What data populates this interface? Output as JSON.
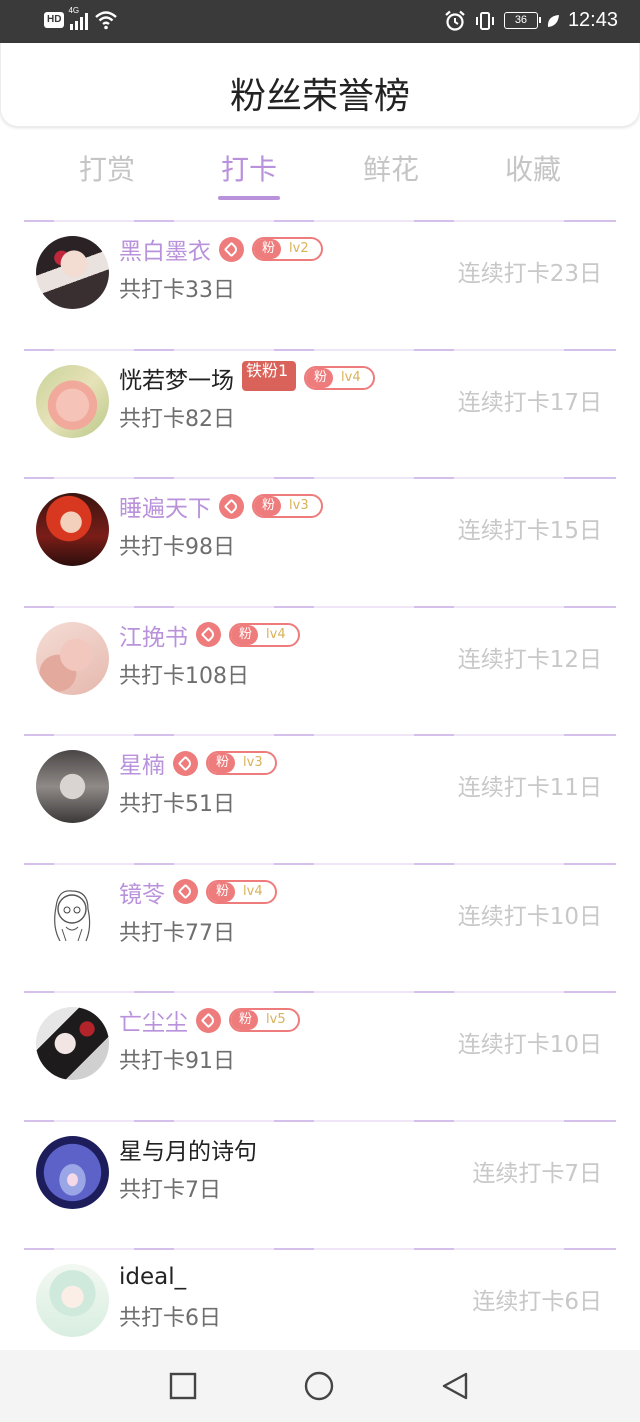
{
  "status_bar": {
    "left_icons": [
      "hd-icon",
      "4g-signal-icon",
      "wifi-icon"
    ],
    "hd_label": "HD",
    "network_label": "4G",
    "right_icons": [
      "alarm-icon",
      "vibrate-icon",
      "battery-icon",
      "leaf-icon"
    ],
    "battery_level": "36",
    "time": "12:43"
  },
  "header": {
    "title": "粉丝荣誉榜"
  },
  "tabs": [
    {
      "label": "打赏",
      "active": false
    },
    {
      "label": "打卡",
      "active": true
    },
    {
      "label": "鲜花",
      "active": false
    },
    {
      "label": "收藏",
      "active": false
    }
  ],
  "colors": {
    "accent": "#b992db",
    "badge_red": "#ee7c7c",
    "muted": "#c8c8c8"
  },
  "fans": [
    {
      "name": "黑白墨衣",
      "highlight": true,
      "badge": "heart",
      "fan_label": "粉",
      "level": "lv2",
      "total": "共打卡33日",
      "streak": "连续打卡23日"
    },
    {
      "name": "恍若梦一场",
      "highlight": false,
      "badge": "iron",
      "iron_label": "铁粉1",
      "fan_label": "粉",
      "level": "lv4",
      "total": "共打卡82日",
      "streak": "连续打卡17日"
    },
    {
      "name": "睡遍天下",
      "highlight": true,
      "badge": "heart",
      "fan_label": "粉",
      "level": "lv3",
      "total": "共打卡98日",
      "streak": "连续打卡15日"
    },
    {
      "name": "江挽书",
      "highlight": true,
      "badge": "heart",
      "fan_label": "粉",
      "level": "lv4",
      "total": "共打卡108日",
      "streak": "连续打卡12日"
    },
    {
      "name": "星楠",
      "highlight": true,
      "badge": "heart",
      "fan_label": "粉",
      "level": "lv3",
      "total": "共打卡51日",
      "streak": "连续打卡11日"
    },
    {
      "name": "镜苓",
      "highlight": true,
      "badge": "heart",
      "fan_label": "粉",
      "level": "lv4",
      "total": "共打卡77日",
      "streak": "连续打卡10日"
    },
    {
      "name": "亡尘尘",
      "highlight": true,
      "badge": "heart",
      "fan_label": "粉",
      "level": "lv5",
      "total": "共打卡91日",
      "streak": "连续打卡10日"
    },
    {
      "name": "星与月的诗句",
      "highlight": false,
      "badge": "none",
      "total": "共打卡7日",
      "streak": "连续打卡7日"
    },
    {
      "name": "ideal_",
      "highlight": false,
      "badge": "none",
      "total": "共打卡6日",
      "streak": "连续打卡6日"
    }
  ],
  "navbar": {
    "icons": [
      "recent-apps-icon",
      "home-icon",
      "back-icon"
    ]
  }
}
